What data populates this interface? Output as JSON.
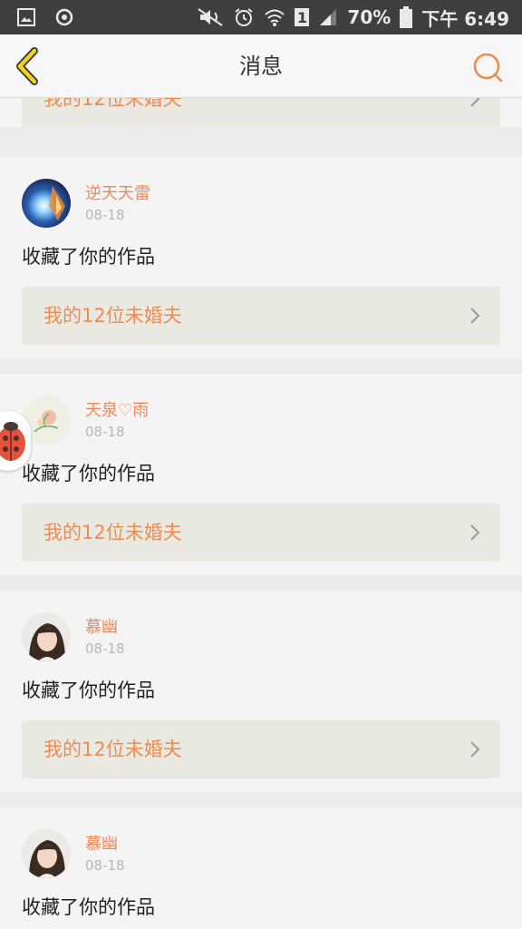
{
  "status_bar": {
    "battery": "70%",
    "time": "下午 6:49",
    "sim": "1",
    "icons": [
      "gallery-icon",
      "record-icon",
      "mute-icon",
      "alarm-icon",
      "wifi-icon",
      "signal-icon",
      "battery-icon"
    ]
  },
  "header": {
    "title": "消息",
    "back_icon": "chevron-left-icon",
    "search_icon": "search-icon"
  },
  "feed": {
    "partial_work": "我的12位未婚夫",
    "items": [
      {
        "user": "逆天天雷",
        "date": "08-18",
        "action": "收藏了你的作品",
        "work": "我的12位未婚夫"
      },
      {
        "user": "天泉♡雨",
        "date": "08-18",
        "action": "收藏了你的作品",
        "work": "我的12位未婚夫"
      },
      {
        "user": "慕幽",
        "date": "08-18",
        "action": "收藏了你的作品",
        "work": "我的12位未婚夫"
      },
      {
        "user": "慕幽",
        "date": "08-18",
        "action": "收藏了你的作品"
      }
    ]
  },
  "colors": {
    "accent": "#ef8b52",
    "header_bg": "#f7f7f7",
    "card_bg": "#f4f4f4",
    "work_bg": "#e9e9e1",
    "back_icon": "#e6c200"
  }
}
